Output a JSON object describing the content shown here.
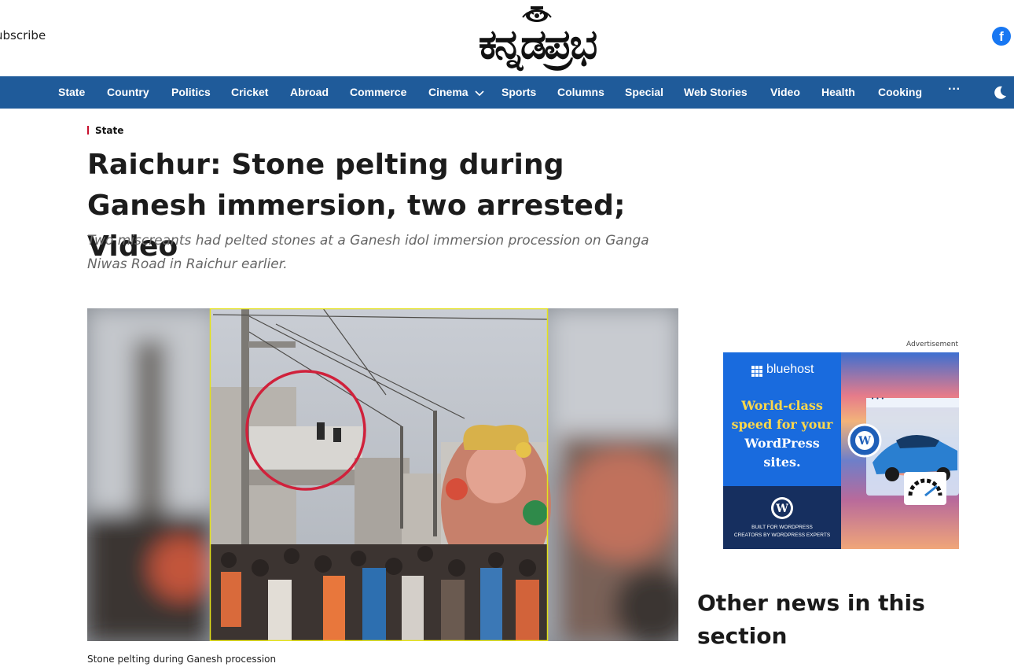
{
  "header": {
    "subscribe_label": "ubscribe",
    "logo_text": "ಕನ್ನಡಪ್ರಭ",
    "facebook_icon": "f"
  },
  "nav": {
    "items": [
      "State",
      "Country",
      "Politics",
      "Cricket",
      "Abroad",
      "Commerce",
      "Cinema",
      "Sports",
      "Columns",
      "Special",
      "Web Stories",
      "Video",
      "Health",
      "Cooking"
    ],
    "more_label": "···",
    "colors": {
      "bar": "#1f5b9a",
      "text": "#ffffff"
    }
  },
  "article": {
    "category": "State",
    "title": "Raichur: Stone pelting during Ganesh immersion, two arrested; Video",
    "subtitle": "Two miscreants had pelted stones at a Ganesh idol immersion procession on Ganga Niwas Road in Raichur earlier.",
    "caption": "Stone pelting during Ganesh procession"
  },
  "sidebar": {
    "ad_label": "Advertisement",
    "ad": {
      "brand": "bluehost",
      "headline_1": "World-class",
      "headline_2": "speed for your",
      "headline_3": "WordPress",
      "headline_4": "sites.",
      "built_1": "BUILT FOR WORDPRESS",
      "built_2": "CREATORS BY WORDPRESS EXPERTS",
      "dots": "• • •"
    },
    "other_news_heading": "Other news in this section"
  }
}
